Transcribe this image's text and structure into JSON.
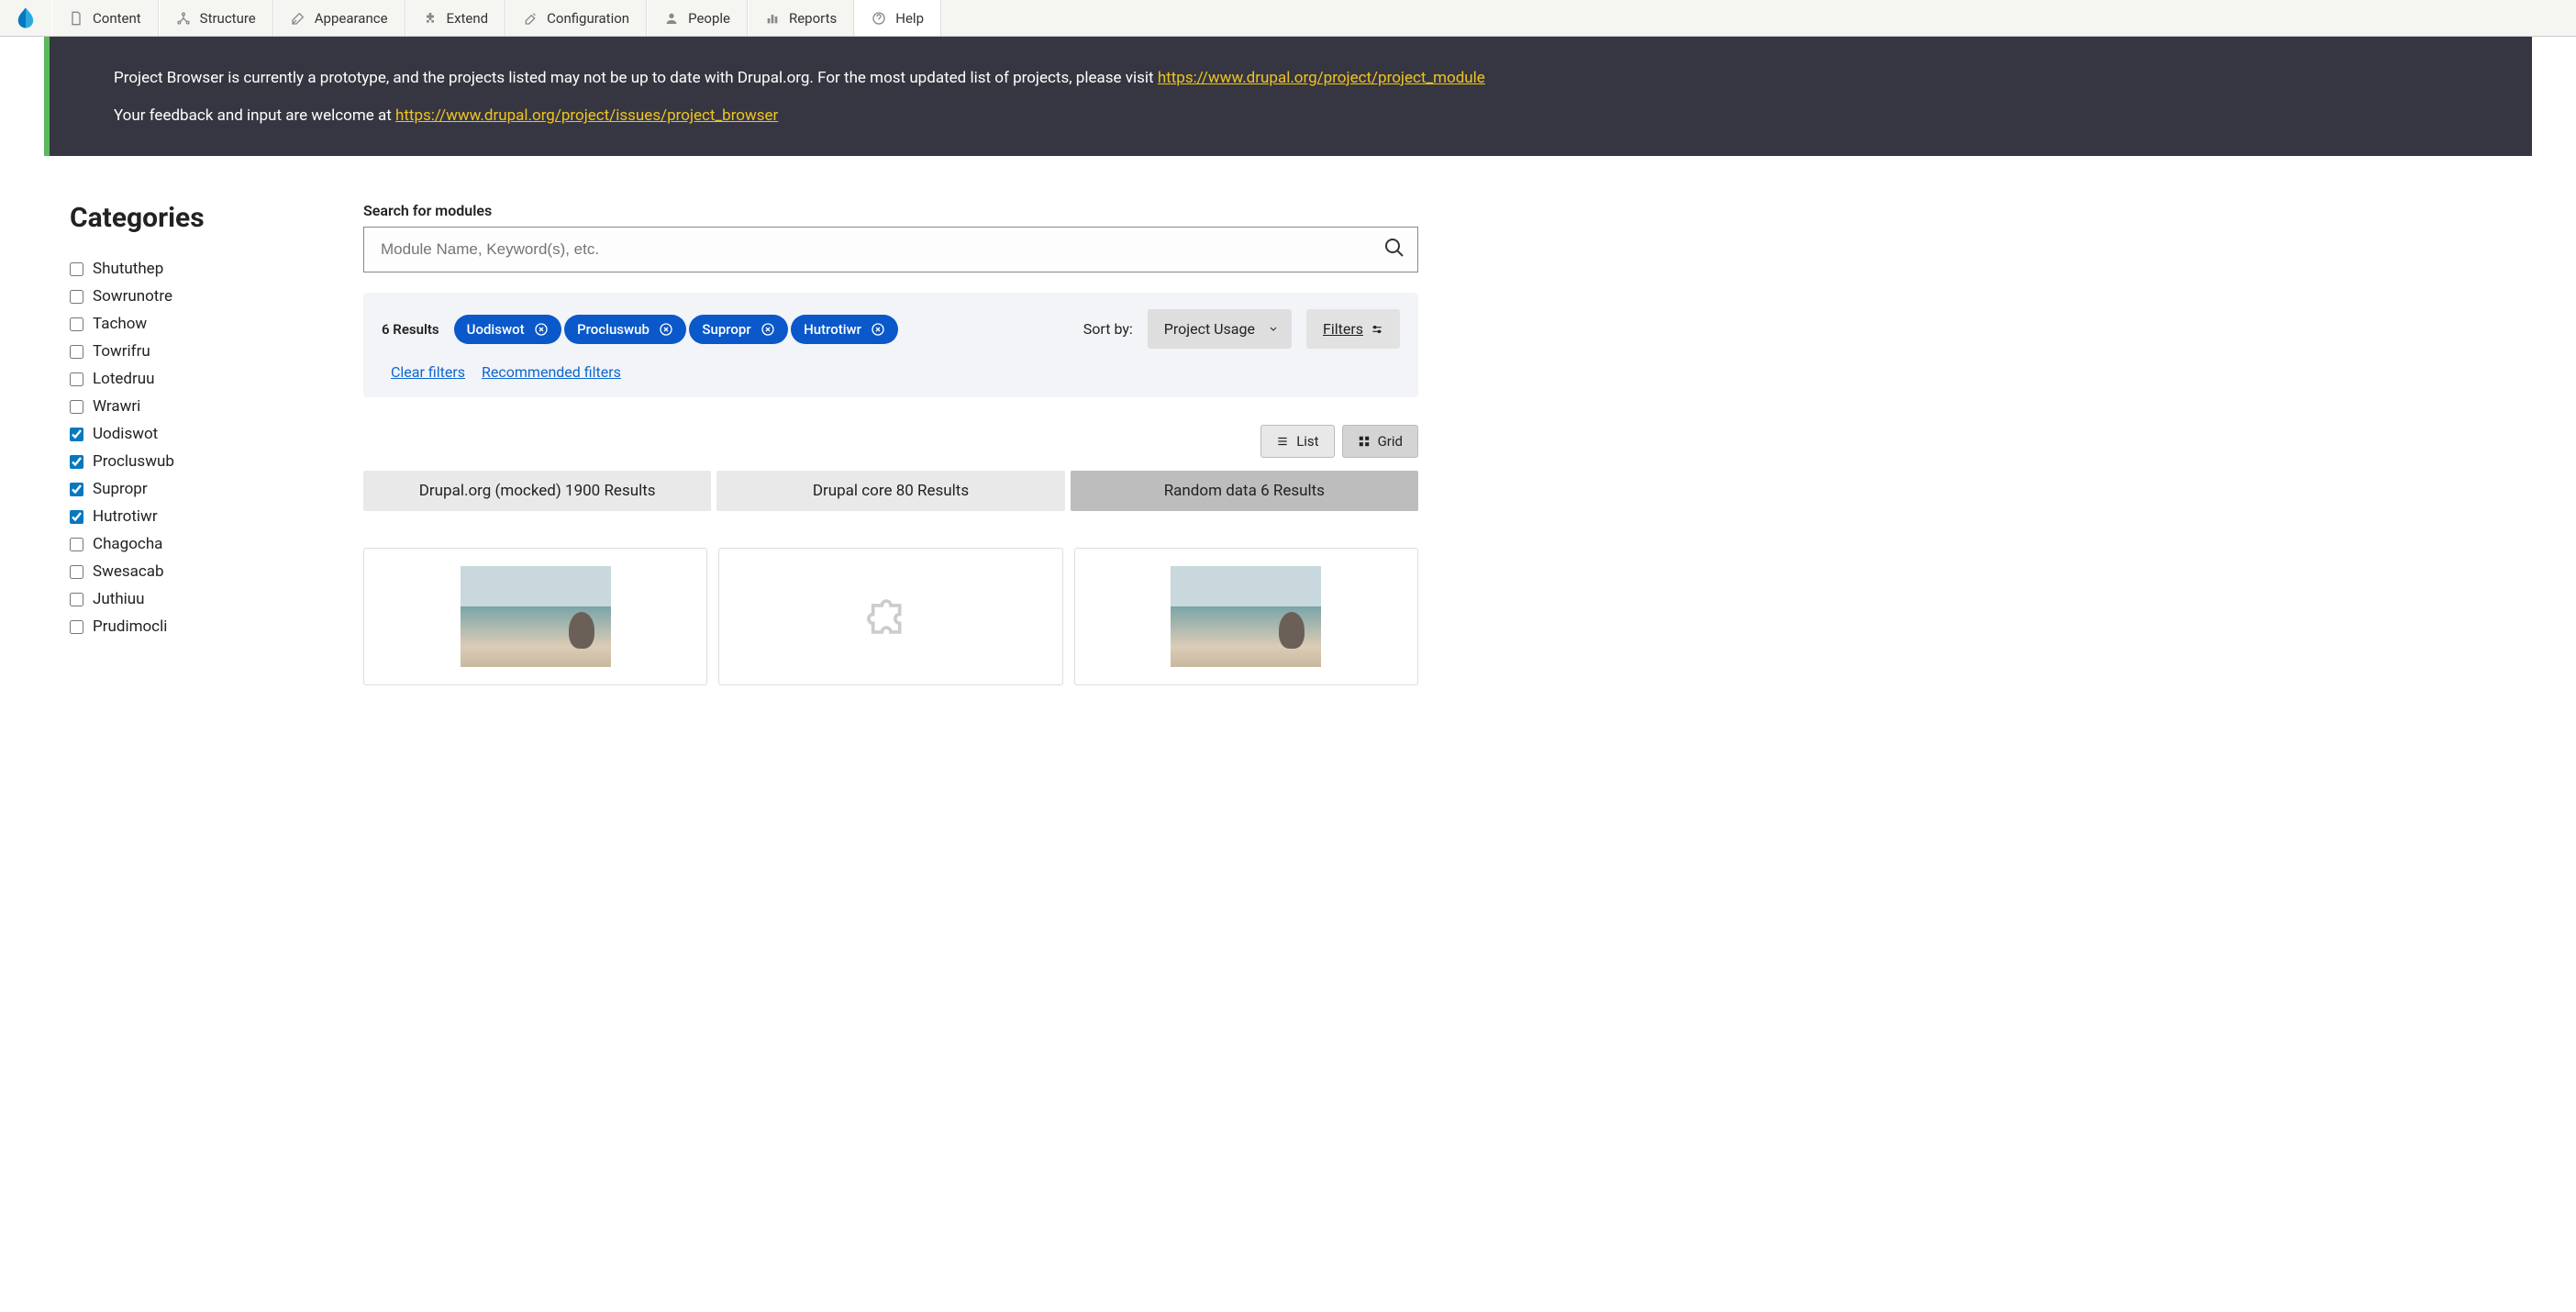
{
  "admin_nav": {
    "items": [
      {
        "label": "Content",
        "icon": "file"
      },
      {
        "label": "Structure",
        "icon": "structure"
      },
      {
        "label": "Appearance",
        "icon": "appearance"
      },
      {
        "label": "Extend",
        "icon": "extend"
      },
      {
        "label": "Configuration",
        "icon": "config"
      },
      {
        "label": "People",
        "icon": "people"
      },
      {
        "label": "Reports",
        "icon": "reports"
      },
      {
        "label": "Help",
        "icon": "help"
      }
    ]
  },
  "status": {
    "line1_pre": "Project Browser is currently a prototype, and the projects listed may not be up to date with Drupal.org. For the most updated list of projects, please visit ",
    "link1": "https://www.drupal.org/project/project_module",
    "line2_pre": "Your feedback and input are welcome at ",
    "link2": "https://www.drupal.org/project/issues/project_browser"
  },
  "sidebar": {
    "heading": "Categories",
    "items": [
      {
        "label": "Shututhep",
        "checked": false
      },
      {
        "label": "Sowrunotre",
        "checked": false
      },
      {
        "label": "Tachow",
        "checked": false
      },
      {
        "label": "Towrifru",
        "checked": false
      },
      {
        "label": "Lotedruu",
        "checked": false
      },
      {
        "label": "Wrawri",
        "checked": false
      },
      {
        "label": "Uodiswot",
        "checked": true
      },
      {
        "label": "Procluswub",
        "checked": true
      },
      {
        "label": "Supropr",
        "checked": true
      },
      {
        "label": "Hutrotiwr",
        "checked": true
      },
      {
        "label": "Chagocha",
        "checked": false
      },
      {
        "label": "Swesacab",
        "checked": false
      },
      {
        "label": "Juthiuu",
        "checked": false
      },
      {
        "label": "Prudimocli",
        "checked": false
      }
    ]
  },
  "search": {
    "label": "Search for modules",
    "placeholder": "Module Name, Keyword(s), etc."
  },
  "filters": {
    "results_count": "6 Results",
    "chips": [
      "Uodiswot",
      "Procluswub",
      "Supropr",
      "Hutrotiwr"
    ],
    "clear": "Clear filters",
    "recommended": "Recommended filters",
    "sort_label": "Sort by:",
    "sort_value": "Project Usage",
    "filters_btn": "Filters"
  },
  "view_toggle": {
    "list": "List",
    "grid": "Grid"
  },
  "source_tabs": [
    {
      "label": "Drupal.org (mocked) 1900 Results",
      "active": false,
      "light": true
    },
    {
      "label": "Drupal core 80 Results",
      "active": false,
      "light": true
    },
    {
      "label": "Random data 6 Results",
      "active": true,
      "light": false
    }
  ]
}
